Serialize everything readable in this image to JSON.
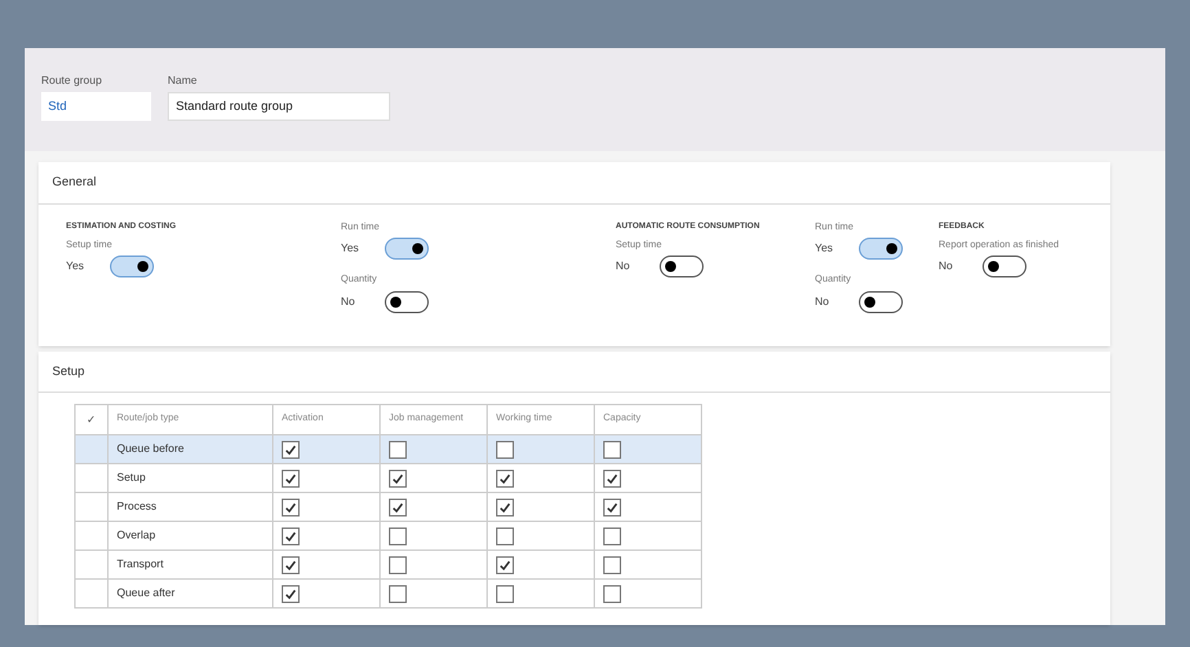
{
  "header": {
    "fields": [
      {
        "label": "Route group",
        "value": "Std"
      },
      {
        "label": "Name",
        "value": "Standard route group"
      }
    ]
  },
  "general": {
    "title": "General",
    "groups": [
      {
        "title": "ESTIMATION AND COSTING",
        "toggles": [
          {
            "label": "Setup time",
            "value": "Yes",
            "on": true
          }
        ]
      },
      {
        "toggles": [
          {
            "label": "Run time",
            "value": "Yes",
            "on": true
          },
          {
            "label": "Quantity",
            "value": "No",
            "on": false
          }
        ]
      },
      {
        "title": "AUTOMATIC ROUTE CONSUMPTION",
        "toggles": [
          {
            "label": "Setup time",
            "value": "No",
            "on": false
          }
        ]
      },
      {
        "toggles": [
          {
            "label": "Run time",
            "value": "Yes",
            "on": true
          },
          {
            "label": "Quantity",
            "value": "No",
            "on": false
          }
        ]
      },
      {
        "title": "FEEDBACK",
        "toggles": [
          {
            "label": "Report operation as finished",
            "value": "No",
            "on": false
          }
        ]
      }
    ]
  },
  "setup": {
    "title": "Setup",
    "table": {
      "check_header": "✓",
      "columns": [
        "Route/job type",
        "Activation",
        "Job management",
        "Working time",
        "Capacity"
      ],
      "rows": [
        {
          "type": "Queue before",
          "selected": true,
          "checks": [
            true,
            false,
            false,
            false
          ]
        },
        {
          "type": "Setup",
          "selected": false,
          "checks": [
            true,
            true,
            true,
            true
          ]
        },
        {
          "type": "Process",
          "selected": false,
          "checks": [
            true,
            true,
            true,
            true
          ]
        },
        {
          "type": "Overlap",
          "selected": false,
          "checks": [
            true,
            false,
            false,
            false
          ]
        },
        {
          "type": "Transport",
          "selected": false,
          "checks": [
            true,
            false,
            true,
            false
          ]
        },
        {
          "type": "Queue after",
          "selected": false,
          "checks": [
            true,
            false,
            false,
            false
          ]
        }
      ]
    }
  }
}
